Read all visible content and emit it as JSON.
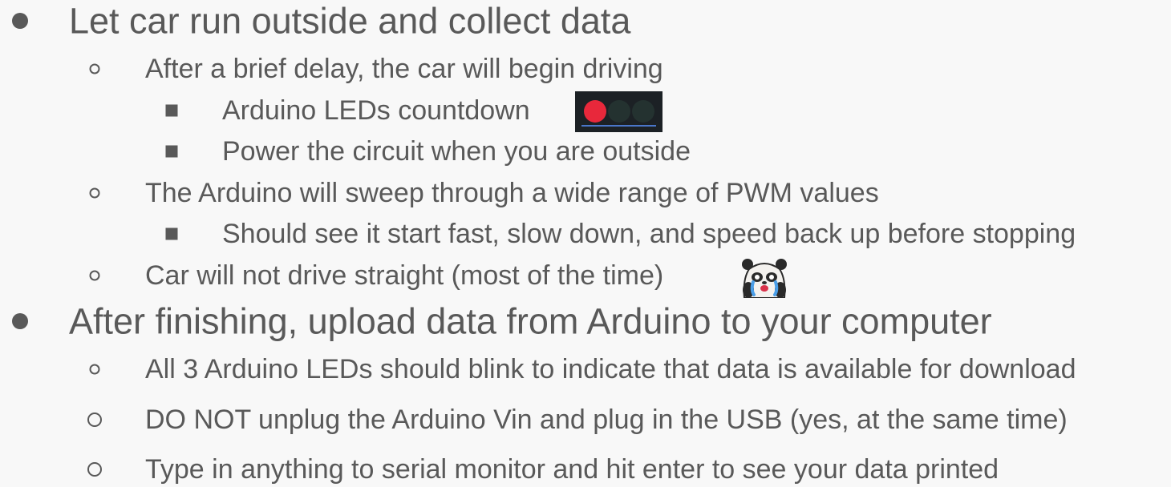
{
  "bullets": [
    "Let car run outside and collect data",
    "After a brief delay, the car will begin driving",
    "Arduino LEDs countdown",
    "Power the circuit when you are outside",
    "The Arduino will sweep through a wide range of PWM values",
    "Should see it start fast, slow down, and speed back up before stopping",
    "Car will not drive straight (most of the time)",
    "After finishing, upload data from Arduino to your computer",
    "All 3 Arduino LEDs should blink to indicate that data is available for download",
    "DO NOT unplug the Arduino Vin and plug in the USB (yes, at the same time)",
    "Type in anything to serial monitor and hit enter to see your data printed"
  ],
  "icons": {
    "led_strip": "led-countdown-icon",
    "panda": "crying-panda-emoji"
  },
  "colors": {
    "text": "#595959",
    "background": "#f8f8f8",
    "led_red": "#e8283b",
    "led_off": "#243230",
    "led_panel": "#1c2125"
  }
}
